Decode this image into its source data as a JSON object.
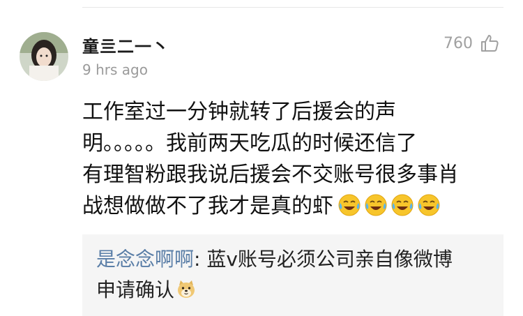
{
  "comment": {
    "username": "童亖二一丶",
    "timestamp": "9 hrs ago",
    "like_count": "760",
    "body_lines": [
      "工作室过一分钟就转了后援会的声",
      "明。。。。。我前两天吃瓜的时候还信了",
      "有理智粉跟我说后援会不交账号很多事肖",
      "战想做做不了我才是真的虾"
    ],
    "trailing_emojis": [
      "laugh-cry",
      "laugh-cry",
      "laugh-cry",
      "laugh-cry"
    ]
  },
  "reply": {
    "author": "是念念啊啊",
    "separator": ": ",
    "line1_text": "蓝v账号必须公司亲自像微博",
    "line2_text": "申请确认",
    "trailing_emoji": "doge"
  },
  "colors": {
    "reply_author": "#5a7ea7",
    "meta_gray": "#9a9a9a",
    "reply_background": "#f5f5f5"
  }
}
